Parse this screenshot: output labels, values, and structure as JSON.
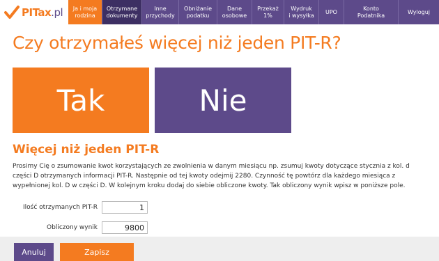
{
  "brand": {
    "name": "PITax",
    "suffix": ".pl"
  },
  "nav": [
    {
      "label": "Ja i moja\nrodzina"
    },
    {
      "label": "Otrzymane\ndokumenty"
    },
    {
      "label": "Inne\nprzychody"
    },
    {
      "label": "Obniżanie\npodatku"
    },
    {
      "label": "Dane\nosobowe"
    },
    {
      "label": "Przekaż\n1%"
    },
    {
      "label": "Wydruk\ni wysyłka"
    },
    {
      "label": "UPO"
    },
    {
      "label": "Konto\nPodatnika"
    },
    {
      "label": "Wyloguj"
    }
  ],
  "main": {
    "question": "Czy otrzymałeś więcej niż jeden PIT-R?",
    "yes_label": "Tak",
    "no_label": "Nie",
    "section_title": "Więcej niż jeden PIT-R",
    "description": "Prosimy Cię o zsumowanie kwot korzystających ze zwolnienia w danym miesiącu np. zsumuj kwoty dotyczące stycznia z kol. d części D otrzymanych informacji PIT-R. Następnie od tej kwoty odejmij 2280. Czynność tę powtórz dla każdego miesiąca z wypełnionej kol. D w części D. W kolejnym kroku dodaj do siebie obliczone kwoty. Tak obliczony wynik wpisz w poniższe pole.",
    "count_label": "Ilość otrzymanych PIT-R",
    "count_value": "1",
    "result_label": "Obliczony wynik",
    "result_value": "9800"
  },
  "footer": {
    "cancel_label": "Anuluj",
    "save_label": "Zapisz"
  },
  "colors": {
    "accent_orange": "#f47b20",
    "brand_purple": "#5d4a8a",
    "active_nav": "#3d2f63"
  }
}
